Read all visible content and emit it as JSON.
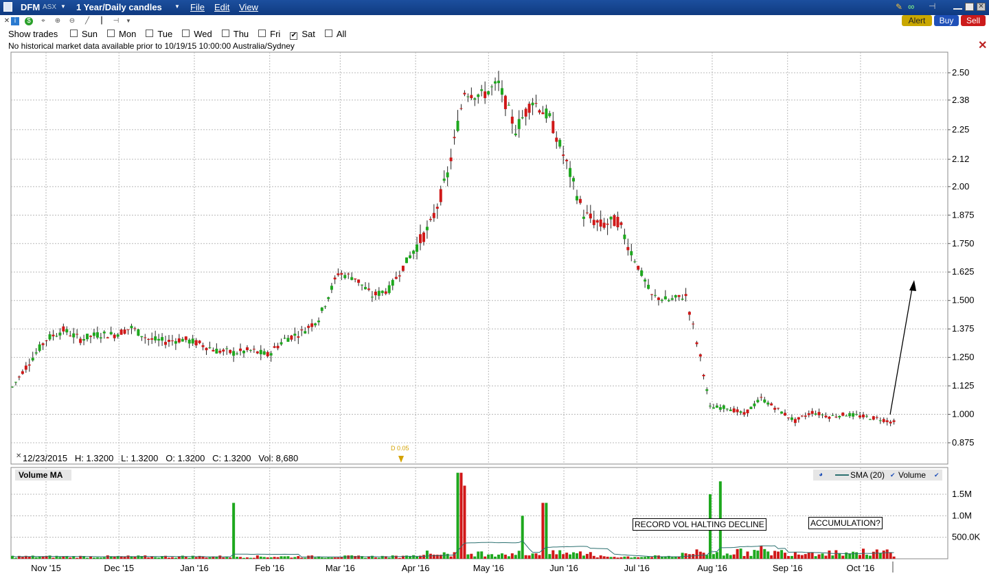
{
  "window": {
    "ticker": "DFM",
    "exchange": "ASX",
    "timeframe": "1 Year/Daily candles",
    "menus": [
      "File",
      "Edit",
      "View"
    ]
  },
  "actions": {
    "alert": "Alert",
    "buy": "Buy",
    "sell": "Sell"
  },
  "show_trades": {
    "label": "Show trades",
    "days": [
      {
        "label": "Sun",
        "checked": false
      },
      {
        "label": "Mon",
        "checked": false
      },
      {
        "label": "Tue",
        "checked": false
      },
      {
        "label": "Wed",
        "checked": false
      },
      {
        "label": "Thu",
        "checked": false
      },
      {
        "label": "Fri",
        "checked": false
      },
      {
        "label": "Sat",
        "checked": true
      },
      {
        "label": "All",
        "checked": false
      }
    ]
  },
  "notice": "No historical market data available prior to 10/19/15 10:00:00 Australia/Sydney",
  "ohlc_readout": {
    "date": "12/23/2015",
    "h": "H: 1.3200",
    "l": "L: 1.3200",
    "o": "O: 1.3200",
    "c": "C: 1.3200",
    "vol": "Vol: 8,680"
  },
  "dividend_marker": "D 0.05",
  "volume_panel": {
    "title": "Volume MA",
    "sma_label": "SMA (20)",
    "volume_label": "Volume"
  },
  "annotations": {
    "record_vol": "RECORD VOL HALTING DECLINE",
    "accumulation": "ACCUMULATION?"
  },
  "colors": {
    "up": "#1ea81e",
    "down": "#d01818",
    "grid": "#b8b8b8",
    "sma": "#2a6f6f",
    "title_bar": "#1c4f9e"
  },
  "chart_data": [
    {
      "type": "candlestick",
      "price_ticks": [
        "2.50",
        "2.38",
        "2.25",
        "2.12",
        "2.00",
        "1.875",
        "1.750",
        "1.625",
        "1.500",
        "1.375",
        "1.250",
        "1.125",
        "1.000",
        "0.875"
      ],
      "ylim": [
        0.83,
        2.56
      ],
      "x_labels": [
        "Nov '15",
        "Dec '15",
        "Jan '16",
        "Feb '16",
        "Mar '16",
        "Apr '16",
        "May '16",
        "Jun '16",
        "Jul '16",
        "Aug '16",
        "Sep '16",
        "Oct '16"
      ],
      "grid": true,
      "close_path": [
        [
          "2015-10-19",
          1.12
        ],
        [
          "2015-10-26",
          1.23
        ],
        [
          "2015-11-02",
          1.33
        ],
        [
          "2015-11-09",
          1.37
        ],
        [
          "2015-11-16",
          1.33
        ],
        [
          "2015-11-23",
          1.35
        ],
        [
          "2015-11-30",
          1.35
        ],
        [
          "2015-12-07",
          1.38
        ],
        [
          "2015-12-14",
          1.33
        ],
        [
          "2015-12-21",
          1.32
        ],
        [
          "2015-12-28",
          1.33
        ],
        [
          "2016-01-04",
          1.31
        ],
        [
          "2016-01-11",
          1.28
        ],
        [
          "2016-01-18",
          1.27
        ],
        [
          "2016-01-25",
          1.28
        ],
        [
          "2016-02-01",
          1.26
        ],
        [
          "2016-02-08",
          1.33
        ],
        [
          "2016-02-15",
          1.36
        ],
        [
          "2016-02-22",
          1.42
        ],
        [
          "2016-03-01",
          1.62
        ],
        [
          "2016-03-08",
          1.6
        ],
        [
          "2016-03-15",
          1.52
        ],
        [
          "2016-03-22",
          1.55
        ],
        [
          "2016-04-01",
          1.72
        ],
        [
          "2016-04-08",
          1.83
        ],
        [
          "2016-04-15",
          2.05
        ],
        [
          "2016-04-22",
          2.42
        ],
        [
          "2016-04-29",
          2.4
        ],
        [
          "2016-05-06",
          2.45
        ],
        [
          "2016-05-13",
          2.25
        ],
        [
          "2016-05-20",
          2.38
        ],
        [
          "2016-05-27",
          2.3
        ],
        [
          "2016-06-03",
          2.1
        ],
        [
          "2016-06-10",
          1.88
        ],
        [
          "2016-06-17",
          1.83
        ],
        [
          "2016-06-24",
          1.85
        ],
        [
          "2016-07-01",
          1.68
        ],
        [
          "2016-07-08",
          1.52
        ],
        [
          "2016-07-15",
          1.5
        ],
        [
          "2016-07-22",
          1.52
        ],
        [
          "2016-07-28",
          1.25
        ],
        [
          "2016-08-01",
          1.03
        ],
        [
          "2016-08-08",
          1.03
        ],
        [
          "2016-08-15",
          1.0
        ],
        [
          "2016-08-22",
          1.07
        ],
        [
          "2016-08-29",
          1.02
        ],
        [
          "2016-09-05",
          0.97
        ],
        [
          "2016-09-12",
          1.01
        ],
        [
          "2016-09-19",
          0.99
        ],
        [
          "2016-09-26",
          1.0
        ],
        [
          "2016-10-03",
          0.99
        ],
        [
          "2016-10-10",
          0.98
        ],
        [
          "2016-10-17",
          0.96
        ]
      ],
      "extrema": {
        "high": 2.49,
        "low": 0.93
      }
    },
    {
      "type": "bar",
      "title": "Volume MA",
      "volume_ticks": [
        "1.5M",
        "1.0M",
        "500.0K"
      ],
      "spikes": [
        [
          "2016-01-18",
          1300000
        ],
        [
          "2016-04-20",
          2000000
        ],
        [
          "2016-04-22",
          1700000
        ],
        [
          "2016-05-16",
          1000000
        ],
        [
          "2016-05-25",
          1300000
        ],
        [
          "2016-08-01",
          1500000
        ],
        [
          "2016-08-05",
          1800000
        ],
        [
          "2016-08-22",
          300000
        ]
      ],
      "series": [
        {
          "name": "SMA (20)",
          "type": "line"
        }
      ]
    }
  ]
}
